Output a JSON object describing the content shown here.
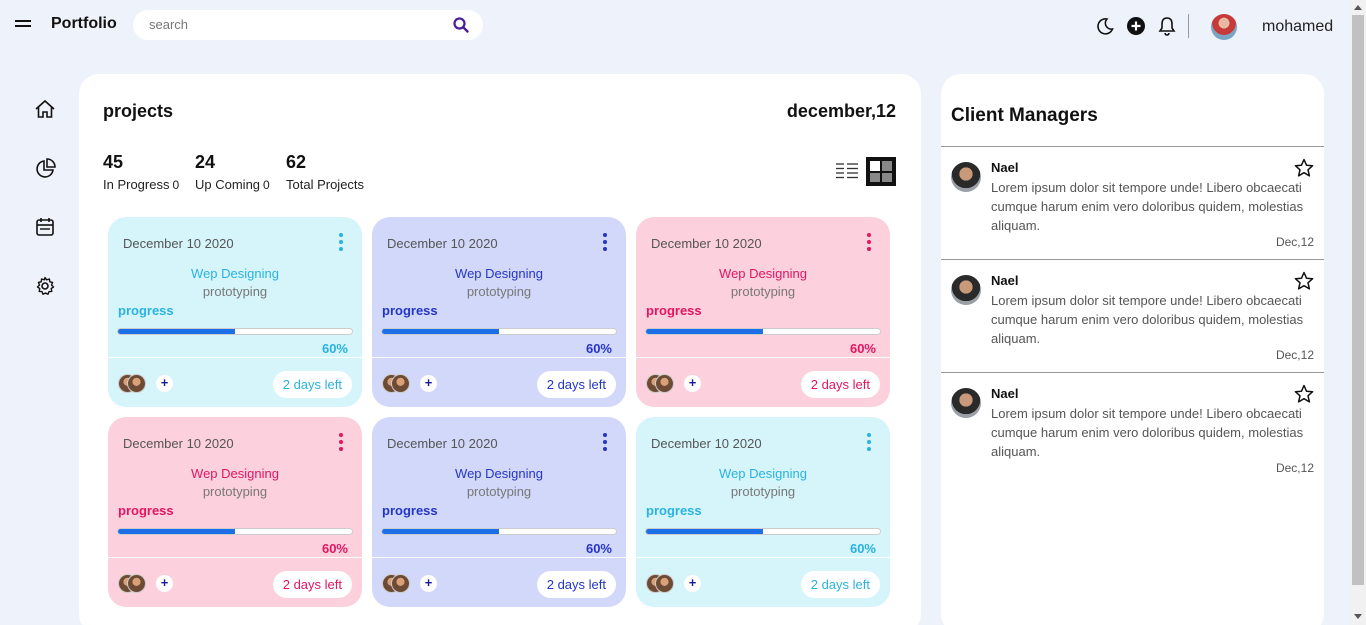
{
  "app": {
    "title": "Portfolio"
  },
  "search": {
    "placeholder": "search"
  },
  "user": {
    "name": "mohamed"
  },
  "header_icons": [
    "moon-icon",
    "plus-circle-icon",
    "bell-icon"
  ],
  "sidenav": [
    "home-icon",
    "pie-chart-icon",
    "calendar-icon",
    "gear-icon"
  ],
  "projects": {
    "title": "projects",
    "date": "december,12",
    "stats": [
      {
        "value": "45",
        "label": "In Progress",
        "suffix": "0"
      },
      {
        "value": "24",
        "label": "Up Coming",
        "suffix": "0"
      },
      {
        "value": "62",
        "label": "Total Projects",
        "suffix": ""
      }
    ],
    "cards": [
      {
        "theme": "cyan",
        "date": "December 10 2020",
        "title": "Wep Designing",
        "subtitle": "prototyping",
        "progress_label": "progress",
        "progress": 0.5,
        "percent_label": "60%",
        "days_left": "2 days left",
        "add": "+"
      },
      {
        "theme": "blue",
        "date": "December 10 2020",
        "title": "Wep Designing",
        "subtitle": "prototyping",
        "progress_label": "progress",
        "progress": 0.5,
        "percent_label": "60%",
        "days_left": "2 days left",
        "add": "+"
      },
      {
        "theme": "pink",
        "date": "December 10 2020",
        "title": "Wep Designing",
        "subtitle": "prototyping",
        "progress_label": "progress",
        "progress": 0.5,
        "percent_label": "60%",
        "days_left": "2 days left",
        "add": "+"
      },
      {
        "theme": "pink",
        "date": "December 10 2020",
        "title": "Wep Designing",
        "subtitle": "prototyping",
        "progress_label": "progress",
        "progress": 0.5,
        "percent_label": "60%",
        "days_left": "2 days left",
        "add": "+"
      },
      {
        "theme": "blue",
        "date": "December 10 2020",
        "title": "Wep Designing",
        "subtitle": "prototyping",
        "progress_label": "progress",
        "progress": 0.5,
        "percent_label": "60%",
        "days_left": "2 days left",
        "add": "+"
      },
      {
        "theme": "cyan",
        "date": "December 10 2020",
        "title": "Wep Designing",
        "subtitle": "prototyping",
        "progress_label": "progress",
        "progress": 0.5,
        "percent_label": "60%",
        "days_left": "2 days left",
        "add": "+"
      }
    ]
  },
  "clients": {
    "title": "Client Managers",
    "items": [
      {
        "name": "Nael",
        "text": "Lorem ipsum dolor sit tempore unde! Libero obcaecati cumque harum enim vero doloribus quidem, molestias aliquam.",
        "date": "Dec,12"
      },
      {
        "name": "Nael",
        "text": "Lorem ipsum dolor sit tempore unde! Libero obcaecati cumque harum enim vero doloribus quidem, molestias aliquam.",
        "date": "Dec,12"
      },
      {
        "name": "Nael",
        "text": "Lorem ipsum dolor sit tempore unde! Libero obcaecati cumque harum enim vero doloribus quidem, molestias aliquam.",
        "date": "Dec,12"
      }
    ]
  },
  "colors": {
    "background": "#eef2fb",
    "accent_bar": "#1d6fe8",
    "cyan": "#2ab3e0",
    "blue": "#2435c7",
    "pink": "#e21561",
    "search_icon": "#4a1d96"
  }
}
